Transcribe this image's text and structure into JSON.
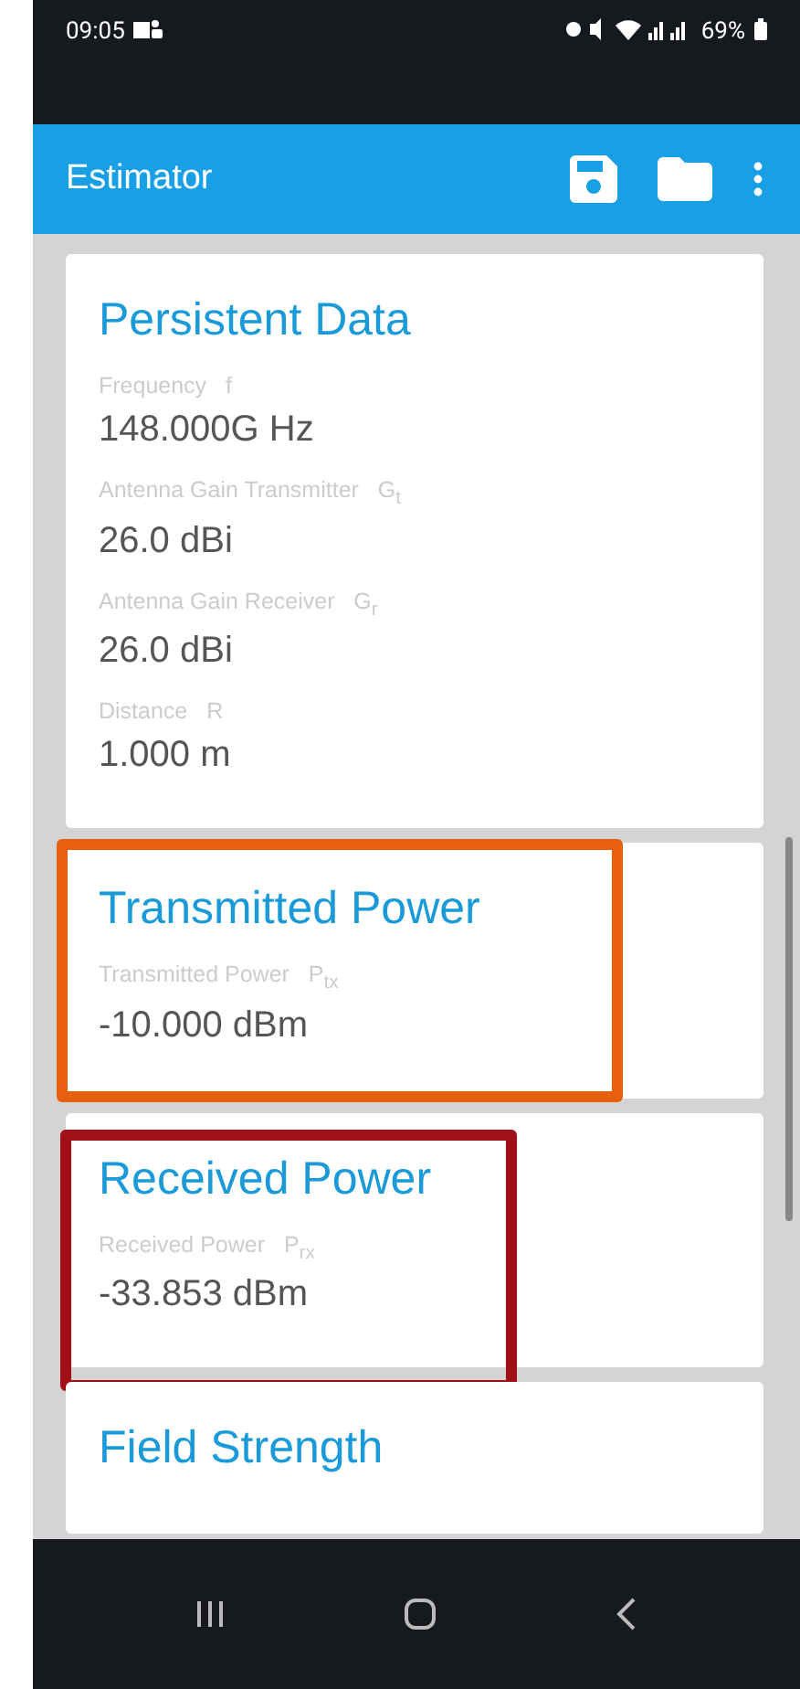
{
  "status_bar": {
    "time": "09:05",
    "battery": "69%"
  },
  "app_bar": {
    "title": "Estimator"
  },
  "sections": [
    {
      "title": "Persistent Data",
      "fields": [
        {
          "label": "Frequency",
          "symbol": "f",
          "value": "148.000G Hz"
        },
        {
          "label": "Antenna Gain Transmitter",
          "symbol": "G$_{t}$",
          "value": "26.0 dBi"
        },
        {
          "label": "Antenna Gain Receiver",
          "symbol": "G$_{r}$",
          "value": "26.0 dBi"
        },
        {
          "label": "Distance",
          "symbol": "R",
          "value": "1.000 m"
        }
      ]
    },
    {
      "title": "Transmitted Power",
      "color": "#e8600f",
      "fields": [
        {
          "label": "Transmitted Power",
          "symbol": "P$_{tx}$",
          "value": "-10.000 dBm"
        }
      ]
    },
    {
      "title": "Received Power",
      "color": "#a01016",
      "fields": [
        {
          "label": "Received Power",
          "symbol": "P$_{rx}$",
          "value": "-33.853 dBm"
        }
      ]
    },
    {
      "title": "Field Strength"
    }
  ]
}
